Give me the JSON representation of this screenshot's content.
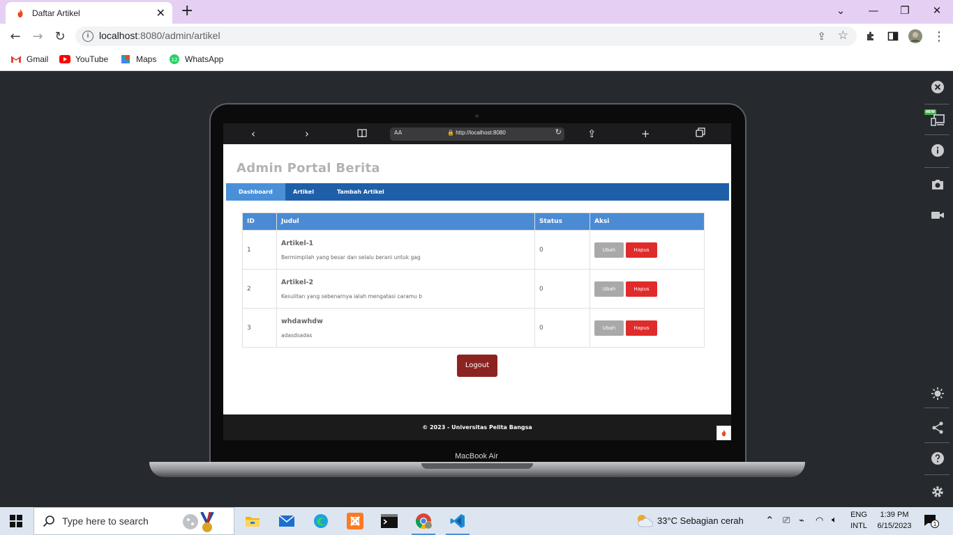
{
  "browser": {
    "tab_title": "Daftar Artikel",
    "url_host": "localhost",
    "url_rest": ":8080/admin/artikel",
    "bookmarks": [
      {
        "label": "Gmail",
        "icon": "gmail-icon"
      },
      {
        "label": "YouTube",
        "icon": "youtube-icon"
      },
      {
        "label": "Maps",
        "icon": "maps-icon"
      },
      {
        "label": "WhatsApp",
        "icon": "whatsapp-icon",
        "badge": "12"
      }
    ]
  },
  "device": {
    "safari_aa": "AA",
    "safari_url": "http://localhost:8080",
    "label": "MacBook Air"
  },
  "site": {
    "title": "Admin Portal Berita",
    "nav": [
      "Dashboard",
      "Artikel",
      "Tambah Artikel"
    ],
    "table_headers": [
      "ID",
      "Judul",
      "Status",
      "Aksi"
    ],
    "rows": [
      {
        "id": "1",
        "title": "Artikel-1",
        "excerpt": "Bermimpilah yang besar dan selalu berani untuk gag",
        "status": "0"
      },
      {
        "id": "2",
        "title": "Artikel-2",
        "excerpt": "Kesulitan yang sebenarnya ialah mengatasi caramu b",
        "status": "0"
      },
      {
        "id": "3",
        "title": "whdawhdw",
        "excerpt": "adasdsadas",
        "status": "0"
      }
    ],
    "edit_label": "Ubah",
    "delete_label": "Hapus",
    "logout_label": "Logout",
    "footer": "© 2023 - Universitas Pelita Bangsa"
  },
  "side_panel": {
    "new_badge": "NEW"
  },
  "taskbar": {
    "search_placeholder": "Type here to search",
    "weather": "33°C  Sebagian cerah",
    "lang_top": "ENG",
    "lang_bottom": "INTL",
    "time": "1:39 PM",
    "date": "6/15/2023",
    "notif_count": "1"
  },
  "colors": {
    "nav": "#1f5fa9",
    "nav_active": "#4a90d9",
    "table_header": "#4a8bd4",
    "delete": "#e02b2b",
    "logout": "#8b2420"
  }
}
